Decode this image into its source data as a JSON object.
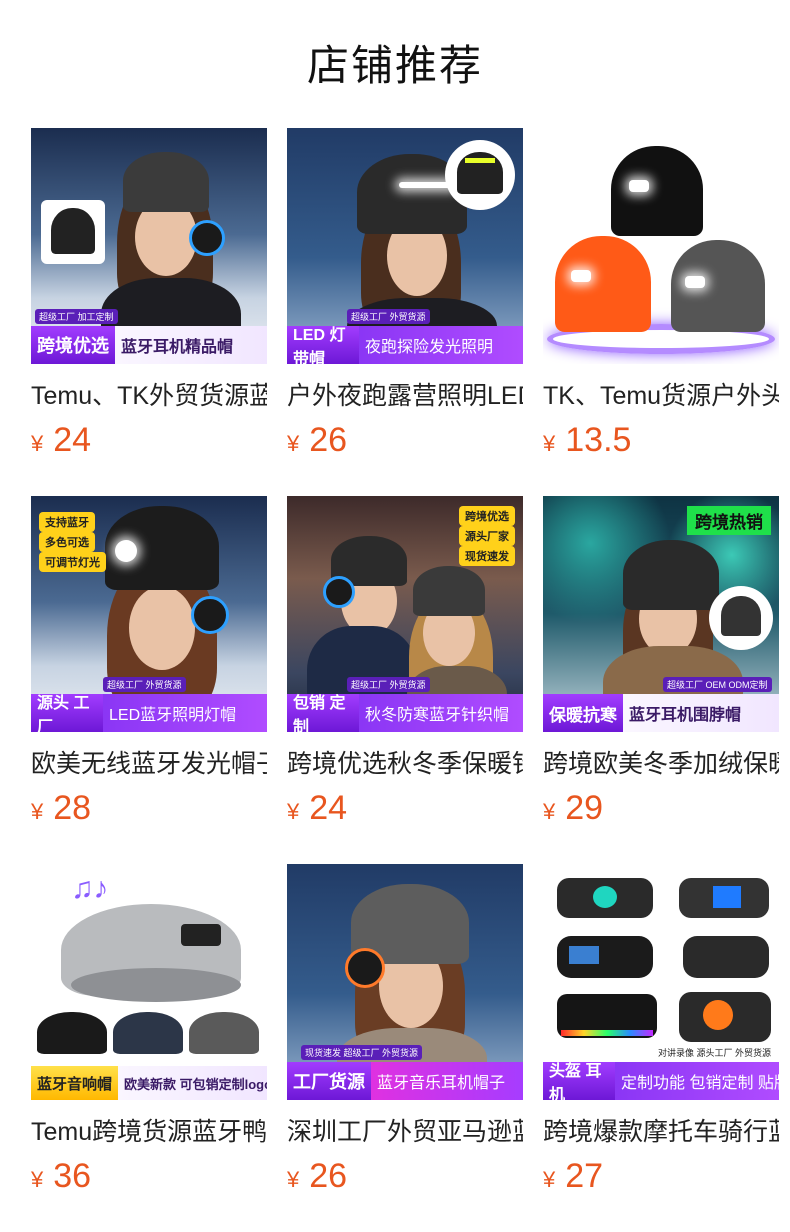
{
  "page": {
    "title": "店铺推荐"
  },
  "colors": {
    "price": "#e8561f",
    "banner_purple": "#7a2cf0",
    "banner_accent": "#b04cff"
  },
  "products": [
    {
      "name": "Temu、TK外贸货源蓝牙耳机帽",
      "currency": "¥",
      "price": "24",
      "image": {
        "tag": "跨境优选",
        "text": "蓝牙耳机精品帽",
        "mini": "超级工厂 加工定制"
      }
    },
    {
      "name": "户外夜跑露营照明LED灯帽",
      "currency": "¥",
      "price": "26",
      "image": {
        "tag": "LED 灯带帽",
        "text": "夜跑探险发光照明",
        "mini": "超级工厂 外贸货源"
      }
    },
    {
      "name": "TK、Temu货源户外头灯帽",
      "currency": "¥",
      "price": "13.5",
      "image": {}
    },
    {
      "name": "欧美无线蓝牙发光帽子",
      "currency": "¥",
      "price": "28",
      "image": {
        "tag": "源头 工厂",
        "text": "LED蓝牙照明灯帽",
        "mini": "超级工厂 外贸货源",
        "pills": [
          "支持蓝牙",
          "多色可选",
          "可调节灯光"
        ]
      }
    },
    {
      "name": "跨境优选秋冬季保暖针织帽",
      "currency": "¥",
      "price": "24",
      "image": {
        "tag": "包销 定制",
        "text": "秋冬防寒蓝牙针织帽",
        "mini": "超级工厂 外贸货源",
        "pills": [
          "跨境优选",
          "源头厂家",
          "现货速发"
        ]
      }
    },
    {
      "name": "跨境欧美冬季加绒保暖帽",
      "currency": "¥",
      "price": "29",
      "image": {
        "tag": "保暖抗寒",
        "text": "蓝牙耳机围脖帽",
        "mini": "超级工厂 OEM ODM定制",
        "corner": "跨境热销"
      }
    },
    {
      "name": "Temu跨境货源蓝牙鸭舌帽",
      "currency": "¥",
      "price": "36",
      "image": {
        "tag": "蓝牙音响帽",
        "text": "欧美新款 可包销定制logo"
      }
    },
    {
      "name": "深圳工厂外贸亚马逊蓝牙帽",
      "currency": "¥",
      "price": "26",
      "image": {
        "tag": "工厂货源",
        "text": "蓝牙音乐耳机帽子",
        "mini": "现货速发 超级工厂 外贸货源"
      }
    },
    {
      "name": "跨境爆款摩托车骑行蓝牙耳机",
      "currency": "¥",
      "price": "27",
      "image": {
        "tag": "头盔 耳机",
        "text": "定制功能 包销定制 贴牌丝印",
        "mini": "对讲录像 源头工厂 外贸货源"
      }
    }
  ]
}
